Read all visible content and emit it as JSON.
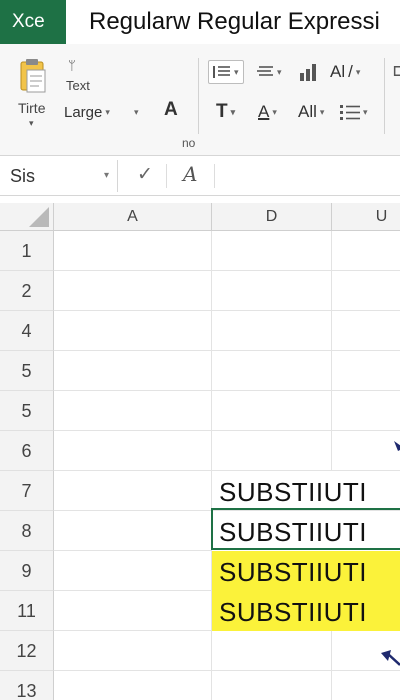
{
  "app": {
    "badge": "Xce",
    "title": "Regularw Regular Expressi"
  },
  "ribbon": {
    "paste_label": "Tirte",
    "text_label": "Text",
    "font_size_label": "Large",
    "font_size_label_caret": "▾",
    "font_size_caret": "▾",
    "bold_glyph": "A",
    "align_format_glyph": "Al",
    "text_style_glyph": "T",
    "font_color_glyph": "A",
    "all_label": "All",
    "group_caption": "no"
  },
  "formula_bar": {
    "name_box": "Sis",
    "name_box_caret": "▾",
    "confirm_glyph": "✓",
    "function_glyph": "A"
  },
  "columns": [
    {
      "label": "A"
    },
    {
      "label": "D"
    },
    {
      "label": "U"
    }
  ],
  "rows": [
    "1",
    "2",
    "4",
    "5",
    "5",
    "6",
    "7",
    "8",
    "9",
    "11",
    "12",
    "13"
  ],
  "cells": {
    "row7": "SUBSTIIUTI",
    "row8": "SUBSTIIUTI",
    "row9": "SUBSTIIUTI",
    "row11": "SUBSTIIUTI"
  },
  "colors": {
    "accent": "#1e7145",
    "highlight": "#fbf23a",
    "arrow": "#1f2a6e"
  }
}
